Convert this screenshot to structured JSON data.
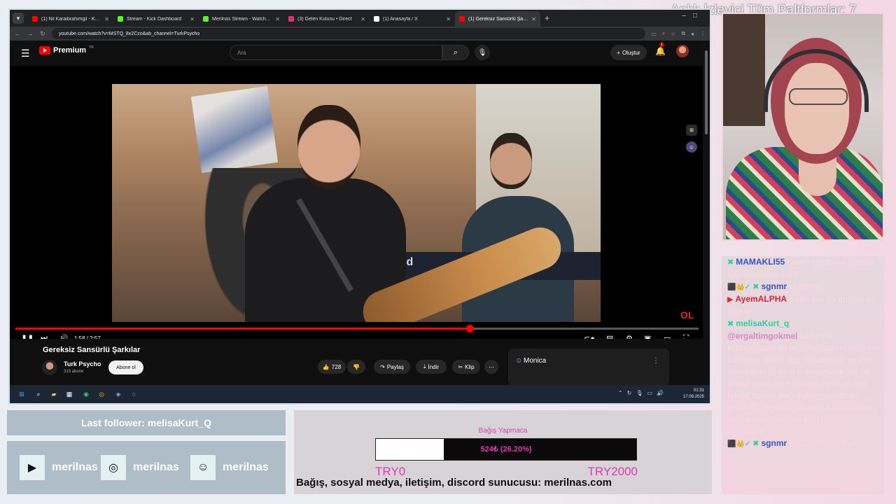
{
  "banner": {
    "text": "Anlık İzleyici Tüm Paltformlar: 7"
  },
  "browser": {
    "tabs": [
      {
        "title": "(1) Nil Karaibrahimgil - Kek (Al...",
        "favicon_color": "#ff0000",
        "active": false
      },
      {
        "title": "Stream - Kick Dashboard",
        "favicon_color": "#53fc18",
        "active": false
      },
      {
        "title": "Merilnas Stream - Watch Live o...",
        "favicon_color": "#53fc18",
        "active": false
      },
      {
        "title": "(3) Gelen Kutusu • Direct",
        "favicon_color": "#e1306c",
        "active": false
      },
      {
        "title": "(1) Anasayfa / X",
        "favicon_color": "#ffffff",
        "active": false
      },
      {
        "title": "(1) Gereksiz Sansürlü Şarkıl...",
        "favicon_color": "#ff0000",
        "active": true
      }
    ],
    "url": "youtube.com/watch?v=MSTQ_8x2Czo&ab_channel=TurkPsycho"
  },
  "youtube": {
    "logo_text": "Premium",
    "country_code": "TR",
    "search_placeholder": "Ara",
    "create_label": "Oluştur",
    "notification_count": "1",
    "player": {
      "time": "1:58 / 2:57",
      "progress": 0.665,
      "keyboard_brand": "Roland",
      "corner_logo": "OL"
    },
    "video_title": "Gereksiz Sansürlü Şarkılar",
    "channel": {
      "name": "Turk Psycho",
      "subscribers": "315 abone",
      "subscribe_label": "Abone ol"
    },
    "actions": {
      "likes": "728",
      "share": "Paylaş",
      "download": "İndir",
      "clip": "Klip"
    },
    "monica_label": "Monica"
  },
  "taskbar": {
    "time": "01:31",
    "date": "17.08.2025"
  },
  "chat": [
    {
      "user": "MAMAKLI55",
      "text": "selam merhaba gizemli babam cinayeti var",
      "color": "#3a57c8",
      "icon": "kick"
    },
    {
      "user": "sgnmr",
      "text": "selam ay",
      "color": "#3a57c8",
      "icon": "kick",
      "badges": "⬛👑✔"
    },
    {
      "user": "AyemALPHA",
      "text": "Baba yok da bunları ag yavrum",
      "color": "#d1263f",
      "icon": "youtube"
    },
    {
      "user": "melisaKurt_q",
      "text": "",
      "color": "#2bd1a2",
      "icon": "kick"
    },
    {
      "user": "@ergaltimgokmel",
      "text": "babamla konuşmuşlar 45 dk anlatıklarına göre ve babamın silaha ağır tabancaydı ve 2 el ateş atmış iki tane polis anlatılması var kapıyı kırdık içeri hakkını helal et dedi tatlığa basmı dedi diğeri camı kırdık girdik 45 dk konuştuk ve 6 katlı emniyet binasında 3 katında kamaralar çalışmıyor",
      "color": "#d58fc6",
      "icon": ""
    },
    {
      "user": "sgnmr",
      "text": "başa al ses var ya",
      "color": "#3a57c8",
      "icon": "kick",
      "badges": "⬛👑✔"
    }
  ],
  "last_follower": {
    "text": "Last follower: melisaKurt_Q"
  },
  "socials": [
    {
      "icon": "youtube-icon",
      "label": "merilnas"
    },
    {
      "icon": "instagram-icon",
      "label": "merilnas"
    },
    {
      "icon": "discord-icon",
      "label": "merilnas"
    }
  ],
  "donation": {
    "title": "Bağış Yapmaca",
    "value_text": "524₺ (26.20%)",
    "progress": 0.262,
    "min_label": "TRY0",
    "max_label": "TRY2000",
    "info": "Bağış, sosyal medya, iletişim, discord sunucusu: merilnas.com"
  },
  "colors": {
    "accent_red": "#ff0000",
    "donation_pink": "#e038b4",
    "panel_blue": "#aebdc8"
  }
}
